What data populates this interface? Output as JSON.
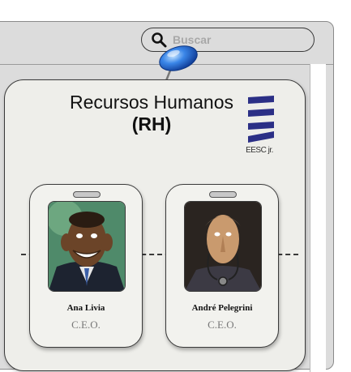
{
  "search": {
    "placeholder": "Buscar",
    "value": ""
  },
  "header": {
    "title_line1": "Recursos Humanos",
    "title_line2": "(RH)"
  },
  "logo": {
    "caption": "EESC jr.",
    "color": "#2b2f86"
  },
  "employees": [
    {
      "name": "Ana Livia",
      "role": "C.E.O."
    },
    {
      "name": "André Pelegrini",
      "role": "C.E.O."
    }
  ],
  "colors": {
    "pin": "#2d6fd6",
    "board": "#eeeeea",
    "window": "#dcdcdc"
  }
}
